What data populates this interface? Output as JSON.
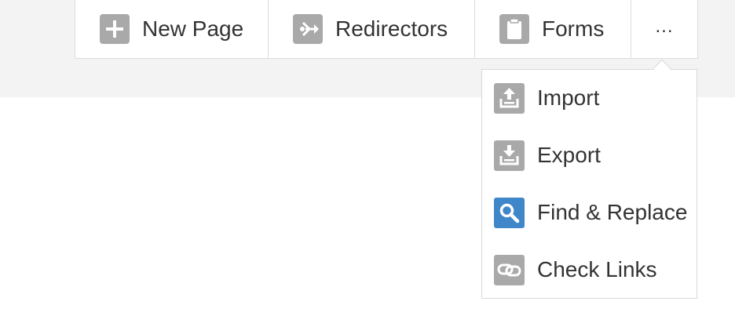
{
  "toolbar": {
    "items": [
      {
        "label": "New Page",
        "icon": "plus-icon",
        "icon_color": "#a9a9a9"
      },
      {
        "label": "Redirectors",
        "icon": "redirect-icon",
        "icon_color": "#a9a9a9"
      },
      {
        "label": "Forms",
        "icon": "clipboard-icon",
        "icon_color": "#a9a9a9"
      }
    ],
    "more_label": "..."
  },
  "dropdown": {
    "items": [
      {
        "label": "Import",
        "icon": "import-icon",
        "icon_color": "#a9a9a9"
      },
      {
        "label": "Export",
        "icon": "export-icon",
        "icon_color": "#a9a9a9"
      },
      {
        "label": "Find & Replace",
        "icon": "magnifier-icon",
        "icon_color": "#3f87c9"
      },
      {
        "label": "Check Links",
        "icon": "link-icon",
        "icon_color": "#a9a9a9"
      }
    ]
  },
  "colors": {
    "band_bg": "#f3f3f3",
    "border": "#dcdcdc",
    "text": "#333333",
    "icon_gray": "#a9a9a9",
    "icon_blue": "#3f87c9"
  }
}
